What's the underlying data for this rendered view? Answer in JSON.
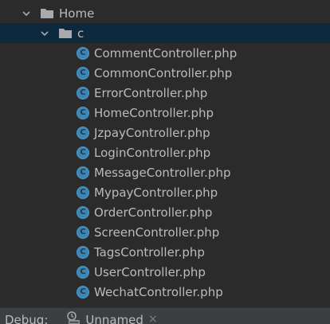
{
  "tree": {
    "root_folder": "Home",
    "sub_folder": "c",
    "files": [
      "CommentController.php",
      "CommonController.php",
      "ErrorController.php",
      "HomeController.php",
      "JzpayController.php",
      "LoginController.php",
      "MessageController.php",
      "MypayController.php",
      "OrderController.php",
      "ScreenController.php",
      "TagsController.php",
      "UserController.php",
      "WechatController.php"
    ],
    "class_icon_letter": "C",
    "icons": {
      "folder": "folder-icon",
      "expand": "chevron-down-icon",
      "php_class": "php-class-icon"
    }
  },
  "debug": {
    "label": "Debug:",
    "tab_label": "Unnamed",
    "close_symbol": "×",
    "icon": "php-debug-icon"
  },
  "colors": {
    "background": "#2b2b2b",
    "selected_row": "#0d293e",
    "text": "#bbbbbb",
    "folder": "#a8aab0",
    "class_icon": "#3b86b5",
    "debug_bar": "#3c3f41"
  }
}
